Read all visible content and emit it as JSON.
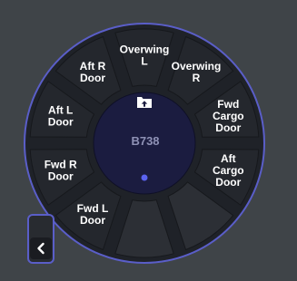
{
  "menu": {
    "center": {
      "aircraft": "B738",
      "folder_icon": "folder-upload-icon",
      "page_indicator_icon": "dot-icon"
    },
    "items": [
      {
        "name": "overwing-l",
        "lines": [
          "Overwing",
          "L"
        ]
      },
      {
        "name": "overwing-r",
        "lines": [
          "Overwing",
          "R"
        ]
      },
      {
        "name": "fwd-cargo-door",
        "lines": [
          "Fwd",
          "Cargo",
          "Door"
        ]
      },
      {
        "name": "aft-cargo-door",
        "lines": [
          "Aft",
          "Cargo",
          "Door"
        ]
      },
      {
        "name": "empty-1",
        "lines": []
      },
      {
        "name": "empty-2",
        "lines": []
      },
      {
        "name": "fwd-l-door",
        "lines": [
          "Fwd L",
          "Door"
        ]
      },
      {
        "name": "fwd-r-door",
        "lines": [
          "Fwd R",
          "Door"
        ]
      },
      {
        "name": "aft-l-door",
        "lines": [
          "Aft L",
          "Door"
        ]
      },
      {
        "name": "aft-r-door",
        "lines": [
          "Aft R",
          "Door"
        ]
      }
    ]
  },
  "back_button": {
    "icon": "chevron-left-icon"
  },
  "colors": {
    "background": "#3f4448",
    "ring": "#1f2228",
    "segment": "#24272d",
    "segment_empty": "#2c2f35",
    "outline": "#5a5ec8",
    "center": "#1b1c40",
    "indicator": "#5b63f0"
  }
}
